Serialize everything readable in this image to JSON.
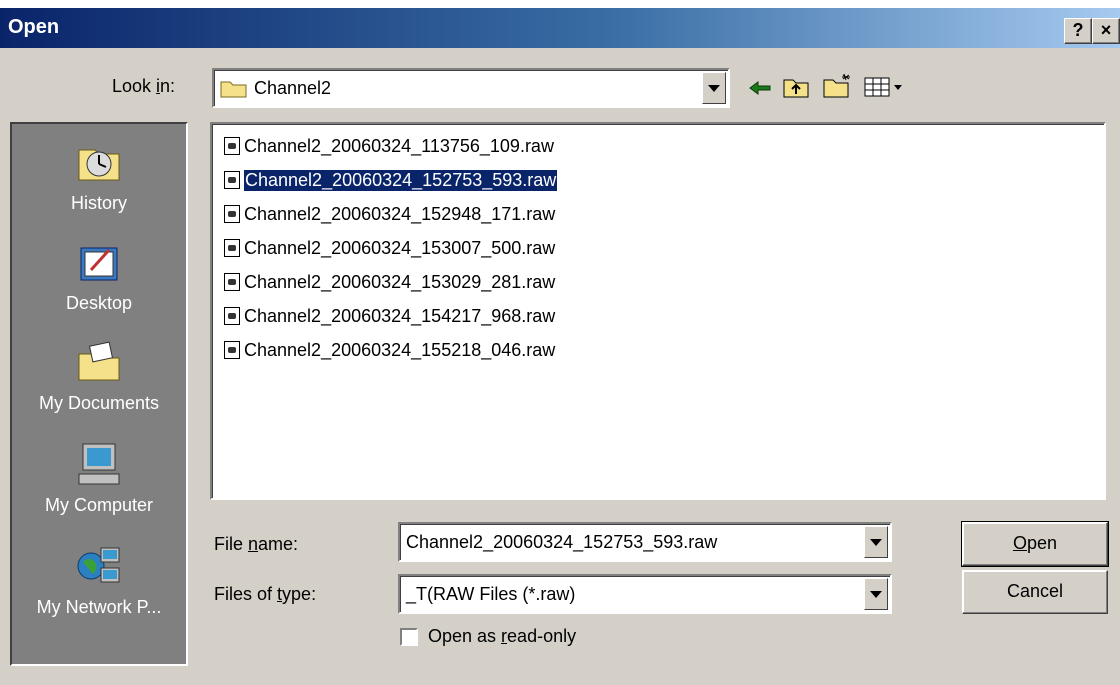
{
  "dialog": {
    "title": "Open",
    "help_btn": "?",
    "close_btn": "×"
  },
  "lookin": {
    "label_pre": "Look ",
    "label_ul": "i",
    "label_post": "n:",
    "value": "Channel2"
  },
  "places": [
    {
      "label": "History",
      "icon": "history-icon"
    },
    {
      "label": "Desktop",
      "icon": "desktop-icon"
    },
    {
      "label": "My Documents",
      "icon": "my-documents-icon"
    },
    {
      "label": "My Computer",
      "icon": "my-computer-icon"
    },
    {
      "label": "My Network P...",
      "icon": "network-places-icon"
    }
  ],
  "files": [
    "Channel2_20060324_113756_109.raw",
    "Channel2_20060324_152753_593.raw",
    "Channel2_20060324_152948_171.raw",
    "Channel2_20060324_153007_500.raw",
    "Channel2_20060324_153029_281.raw",
    "Channel2_20060324_154217_968.raw",
    "Channel2_20060324_155218_046.raw"
  ],
  "selected_file_index": 1,
  "filename": {
    "label_pre": "File ",
    "label_ul": "n",
    "label_post": "ame:",
    "value": "Channel2_20060324_152753_593.raw"
  },
  "filetype": {
    "label_pre": "Files of ",
    "label_ul": "t",
    "label_post": "ype:",
    "value": "_T(RAW Files (*.raw)"
  },
  "readonly": {
    "label_pre": "Open as ",
    "label_ul": "r",
    "label_post": "ead-only",
    "checked": false
  },
  "buttons": {
    "open_ul": "O",
    "open_rest": "pen",
    "cancel": "Cancel"
  }
}
